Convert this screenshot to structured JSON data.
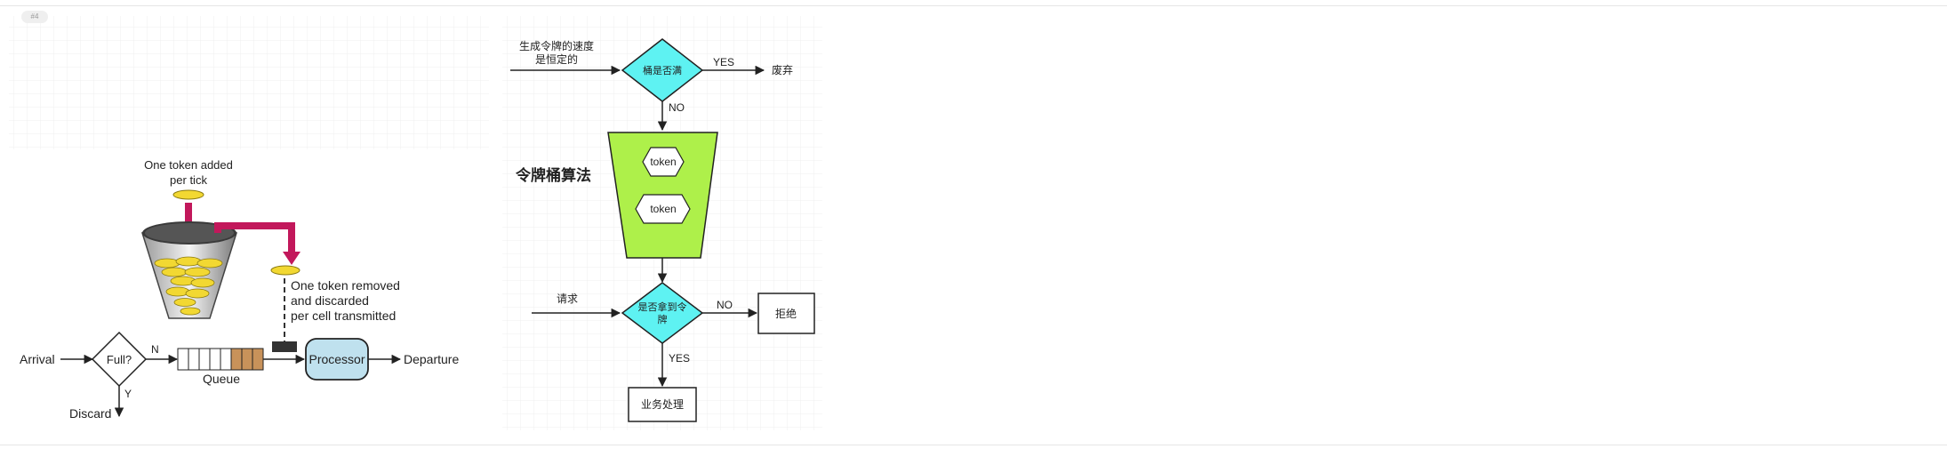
{
  "tag": {
    "label": "#4"
  },
  "token_bucket_figure": {
    "added_label_1": "One token added",
    "added_label_2": "per tick",
    "removed_label_1": "One token removed",
    "removed_label_2": "and discarded",
    "removed_label_3": "per cell transmitted",
    "arrival": "Arrival",
    "full": "Full?",
    "n": "N",
    "y": "Y",
    "queue": "Queue",
    "processor": "Processor",
    "departure": "Departure",
    "discard": "Discard"
  },
  "flowchart": {
    "rate_label_1": "生成令牌的速度",
    "rate_label_2": "是恒定的",
    "bucket_full": "桶是否满",
    "yes_1": "YES",
    "discard": "废弃",
    "no_1": "NO",
    "title": "令牌桶算法",
    "token_1": "token",
    "token_2": "token",
    "request": "请求",
    "got_token_1": "是否拿到令",
    "got_token_2": "牌",
    "no_2": "NO",
    "reject": "拒绝",
    "yes_2": "YES",
    "process": "业务处理"
  },
  "colors": {
    "diamond_cyan": "#5ef2f2",
    "bucket_green": "#aef04a",
    "processor_blue": "#bfe1ee",
    "arrow_magenta": "#c2185b",
    "coin_gold": "#f2d832",
    "queue_brown": "#c8925a"
  }
}
